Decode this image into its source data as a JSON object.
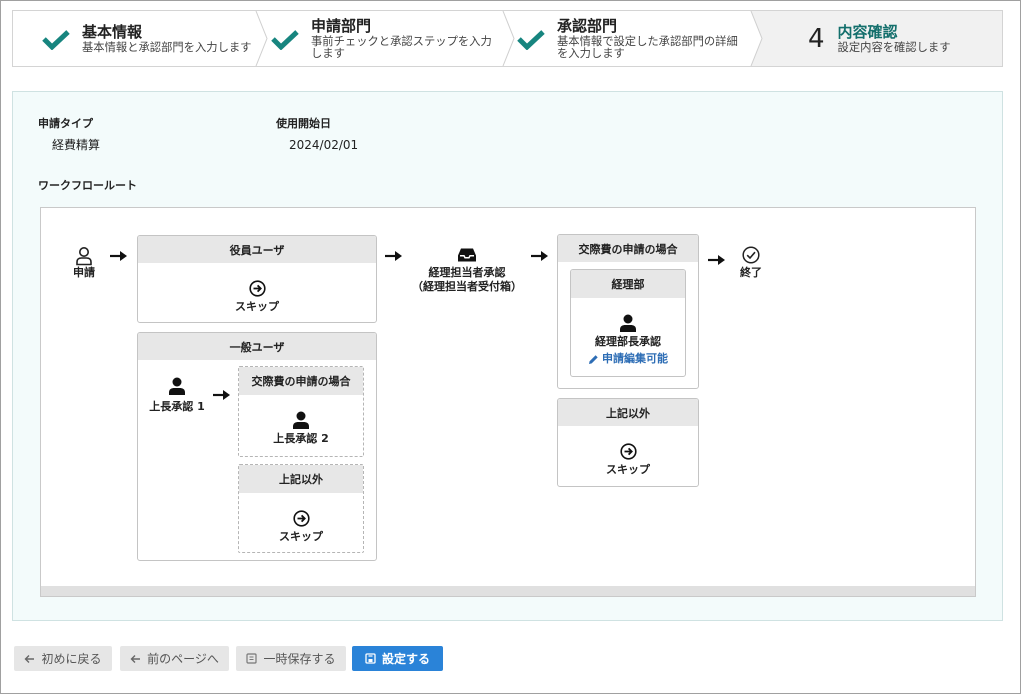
{
  "colors": {
    "accent_teal": "#17857f",
    "current_step_title": "#136f6c",
    "panel_background": "#f3fbfb",
    "primary_button": "#2a83d8",
    "edit_link": "#2d6db5"
  },
  "stepper": {
    "steps": [
      {
        "icon": "check-icon",
        "title": "基本情報",
        "description": "基本情報と承認部門を入力します"
      },
      {
        "icon": "check-icon",
        "title": "申請部門",
        "description": "事前チェックと承認ステップを入力します"
      },
      {
        "icon": "check-icon",
        "title": "承認部門",
        "description": "基本情報で設定した承認部門の詳細を入力します"
      },
      {
        "number": "4",
        "title": "内容確認",
        "description": "設定内容を確認します"
      }
    ]
  },
  "summary": {
    "application_type_label": "申請タイプ",
    "application_type_value": "経費精算",
    "start_date_label": "使用開始日",
    "start_date_value": "2024/02/01"
  },
  "workflow": {
    "heading": "ワークフロールート",
    "start": {
      "icon": "user-outline-icon",
      "label": "申請"
    },
    "executive_users": {
      "title": "役員ユーザ",
      "icon": "circle-arrow-right-icon",
      "action": "スキップ"
    },
    "general_users": {
      "title": "一般ユーザ",
      "first_approval": {
        "icon": "user-icon",
        "label": "上長承認 1"
      },
      "branches": [
        {
          "title": "交際費の申請の場合",
          "icon": "user-icon",
          "label": "上長承認 2"
        },
        {
          "title": "上記以外",
          "icon": "circle-arrow-right-icon",
          "label": "スキップ"
        }
      ]
    },
    "accounting_step": {
      "icon": "inbox-icon",
      "label": "経理担当者承認",
      "sublabel": "（経理担当者受付箱）"
    },
    "accounting_branches": [
      {
        "title": "交際費の申請の場合",
        "department": "経理部",
        "icon": "user-icon",
        "label": "経理部長承認",
        "note_icon": "pencil-icon",
        "note": "申請編集可能"
      },
      {
        "title": "上記以外",
        "icon": "circle-arrow-right-icon",
        "label": "スキップ"
      }
    ],
    "end": {
      "icon": "check-circle-icon",
      "label": "終了"
    }
  },
  "footer": {
    "buttons": [
      {
        "icon": "arrow-left-icon",
        "label": "初めに戻る"
      },
      {
        "icon": "arrow-left-icon",
        "label": "前のページへ"
      },
      {
        "icon": "save-draft-icon",
        "label": "一時保存する"
      },
      {
        "icon": "save-icon",
        "label": "設定する"
      }
    ]
  }
}
